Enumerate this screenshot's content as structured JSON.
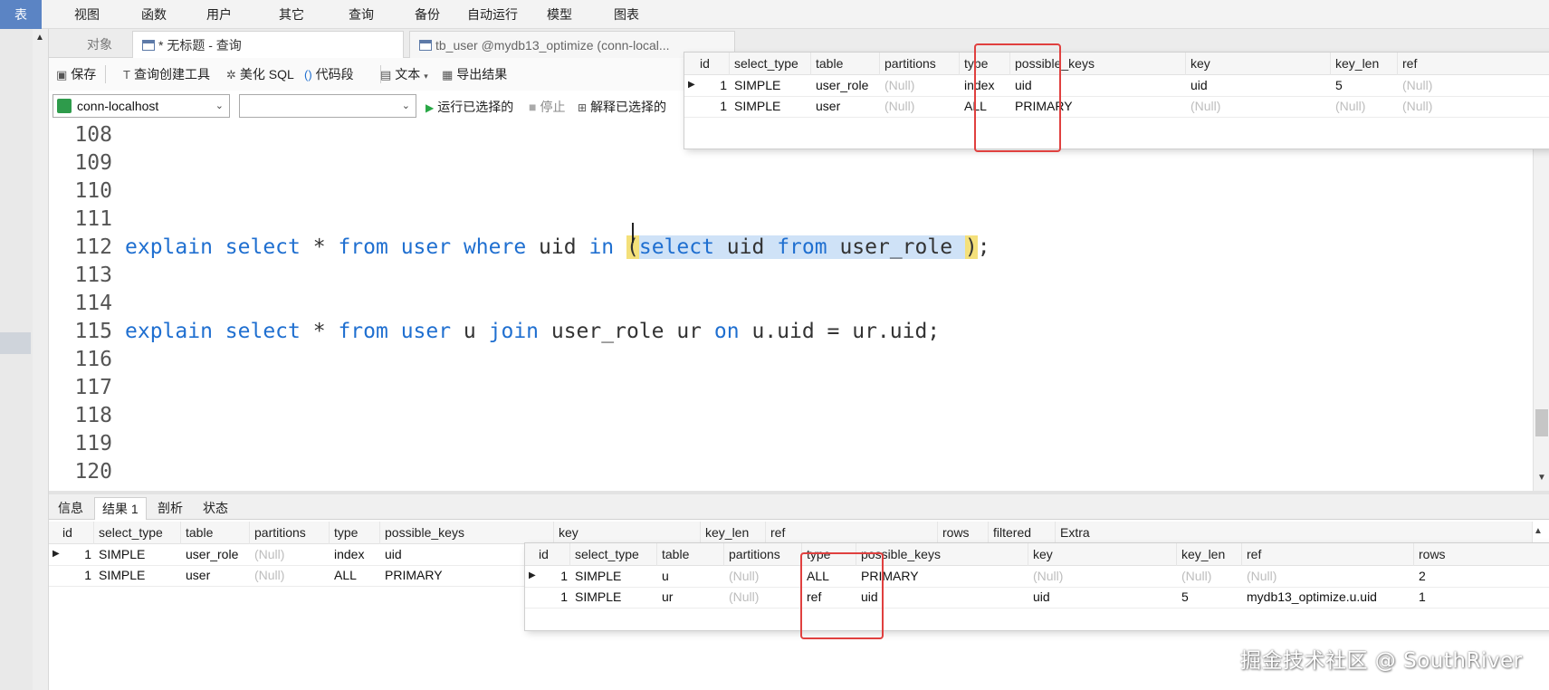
{
  "menu": {
    "items": [
      "表",
      "视图",
      "函数",
      "用户",
      "其它",
      "查询",
      "备份",
      "自动运行",
      "模型",
      "图表"
    ]
  },
  "tabs": {
    "objects": "对象",
    "query": "* 无标题 - 查询",
    "tb_user": "tb_user @mydb13_optimize (conn-local..."
  },
  "toolbar": {
    "save": "保存",
    "query_builder": "查询创建工具",
    "beautify": "美化 SQL",
    "snippet": "代码段",
    "text": "文本",
    "export": "导出结果"
  },
  "connection": {
    "selected": "conn-localhost",
    "database": "",
    "run_selected": "运行已选择的",
    "stop": "停止",
    "explain_selected": "解释已选择的"
  },
  "editor": {
    "lines": [
      {
        "n": "108"
      },
      {
        "n": "109"
      },
      {
        "n": "110"
      },
      {
        "n": "111"
      },
      {
        "n": "112",
        "segments": [
          {
            "t": "explain",
            "k": "kw"
          },
          {
            "t": " ",
            "k": "txt"
          },
          {
            "t": "select",
            "k": "kw"
          },
          {
            "t": " * ",
            "k": "txt"
          },
          {
            "t": "from",
            "k": "kw"
          },
          {
            "t": " ",
            "k": "txt"
          },
          {
            "t": "user",
            "k": "kw"
          },
          {
            "t": " ",
            "k": "txt"
          },
          {
            "t": "where",
            "k": "kw"
          },
          {
            "t": " uid ",
            "k": "txt"
          },
          {
            "t": "in",
            "k": "kw"
          },
          {
            "t": " ",
            "k": "txt"
          },
          {
            "t": "(",
            "k": "txt paren-hl"
          },
          {
            "t": "select",
            "k": "kw hl"
          },
          {
            "t": " uid ",
            "k": "txt hl"
          },
          {
            "t": "from",
            "k": "kw hl"
          },
          {
            "t": " user_role ",
            "k": "txt hl"
          },
          {
            "t": ")",
            "k": "txt paren-hl"
          },
          {
            "t": ";",
            "k": "txt"
          }
        ]
      },
      {
        "n": "113"
      },
      {
        "n": "114"
      },
      {
        "n": "115",
        "segments": [
          {
            "t": "explain",
            "k": "kw"
          },
          {
            "t": " ",
            "k": "txt"
          },
          {
            "t": "select",
            "k": "kw"
          },
          {
            "t": " * ",
            "k": "txt"
          },
          {
            "t": "from",
            "k": "kw"
          },
          {
            "t": " ",
            "k": "txt"
          },
          {
            "t": "user",
            "k": "kw"
          },
          {
            "t": " u ",
            "k": "txt"
          },
          {
            "t": "join",
            "k": "kw"
          },
          {
            "t": " user_role ur ",
            "k": "txt"
          },
          {
            "t": "on",
            "k": "kw"
          },
          {
            "t": " u.uid = ur.uid;",
            "k": "txt"
          }
        ]
      },
      {
        "n": "116"
      },
      {
        "n": "117"
      },
      {
        "n": "118"
      },
      {
        "n": "119"
      },
      {
        "n": "120"
      }
    ]
  },
  "result_tabs": [
    "信息",
    "结果 1",
    "剖析",
    "状态"
  ],
  "main_grid": {
    "headers": [
      "id",
      "select_type",
      "table",
      "partitions",
      "type",
      "possible_keys",
      "key",
      "key_len",
      "ref",
      "rows",
      "filtered",
      "Extra"
    ],
    "rows": [
      [
        "1",
        "SIMPLE",
        "user_role",
        "(Null)",
        "index",
        "uid"
      ],
      [
        "1",
        "SIMPLE",
        "user",
        "(Null)",
        "ALL",
        "PRIMARY"
      ]
    ]
  },
  "overlay_top": {
    "headers": [
      "id",
      "select_type",
      "table",
      "partitions",
      "type",
      "possible_keys",
      "key",
      "key_len",
      "ref"
    ],
    "rows": [
      [
        "1",
        "SIMPLE",
        "user_role",
        "(Null)",
        "index",
        "uid",
        "uid",
        "5",
        "(Null)"
      ],
      [
        "1",
        "SIMPLE",
        "user",
        "(Null)",
        "ALL",
        "PRIMARY",
        "(Null)",
        "(Null)",
        "(Null)"
      ]
    ]
  },
  "overlay_bottom": {
    "headers": [
      "id",
      "select_type",
      "table",
      "partitions",
      "type",
      "possible_keys",
      "key",
      "key_len",
      "ref",
      "rows"
    ],
    "rows": [
      [
        "1",
        "SIMPLE",
        "u",
        "(Null)",
        "ALL",
        "PRIMARY",
        "(Null)",
        "(Null)",
        "(Null)",
        "2"
      ],
      [
        "1",
        "SIMPLE",
        "ur",
        "(Null)",
        "ref",
        "uid",
        "uid",
        "5",
        "mydb13_optimize.u.uid",
        "1"
      ]
    ]
  },
  "watermark": "掘金技术社区 @ SouthRiver",
  "colors": {
    "keyword": "#1f6fd0",
    "highlight_box": "#e0403f",
    "menu_active": "#5b84c4"
  }
}
